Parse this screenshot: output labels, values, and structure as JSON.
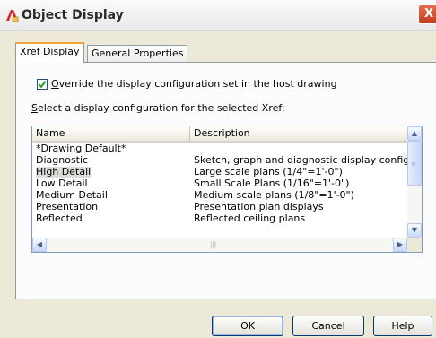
{
  "window": {
    "title": "Object Display",
    "close_symbol": "X"
  },
  "tabs": [
    {
      "label": "Xref Display",
      "active": true
    },
    {
      "label": "General Properties",
      "active": false
    }
  ],
  "override": {
    "checked": true,
    "accel": "O",
    "label_rest": "verride the display configuration set in the host drawing"
  },
  "select_label": {
    "accel": "S",
    "rest": "elect a display configuration for the selected Xref:"
  },
  "list": {
    "columns": [
      "Name",
      "Description"
    ],
    "rows": [
      {
        "name": "*Drawing Default*",
        "description": ""
      },
      {
        "name": "Diagnostic",
        "description": "Sketch, graph and diagnostic display configur."
      },
      {
        "name": "High Detail",
        "description": "Large scale plans (1/4\"=1'-0\")",
        "selected": true
      },
      {
        "name": "Low Detail",
        "description": "Small Scale Plans (1/16\"=1'-0\")"
      },
      {
        "name": "Medium Detail",
        "description": "Medium scale plans (1/8\"=1'-0\")"
      },
      {
        "name": "Presentation",
        "description": "Presentation plan displays"
      },
      {
        "name": "Reflected",
        "description": "Reflected ceiling plans"
      }
    ]
  },
  "buttons": {
    "ok": "OK",
    "cancel": "Cancel",
    "help": "Help"
  },
  "colors": {
    "accent_tab": "#f4a634",
    "check": "#21a121",
    "selection": "#dcdcd8"
  }
}
